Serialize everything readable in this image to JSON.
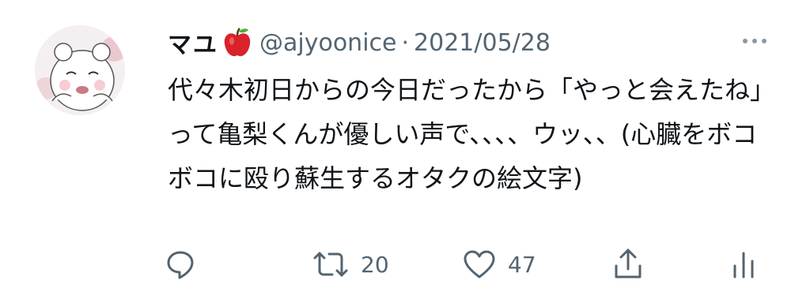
{
  "tweet": {
    "display_name": "マユ",
    "name_emoji_icon": "red-apple-icon",
    "handle": "@ajyoonice",
    "separator": "·",
    "date": "2021/05/28",
    "text": "代々木初日からの今日だったから「やっと会えたね」って亀梨くんが優しい声で、、、、ウッ、、(心臓をボコボコに殴り蘇生するオタクの絵文字)"
  },
  "actions": {
    "reply_icon": "reply-icon",
    "retweet_icon": "retweet-icon",
    "retweet_count": "20",
    "like_icon": "heart-icon",
    "like_count": "47",
    "share_icon": "share-icon",
    "analytics_icon": "analytics-icon"
  },
  "colors": {
    "text": "#0f1419",
    "secondary": "#536471",
    "apple_red": "#d8232a"
  }
}
